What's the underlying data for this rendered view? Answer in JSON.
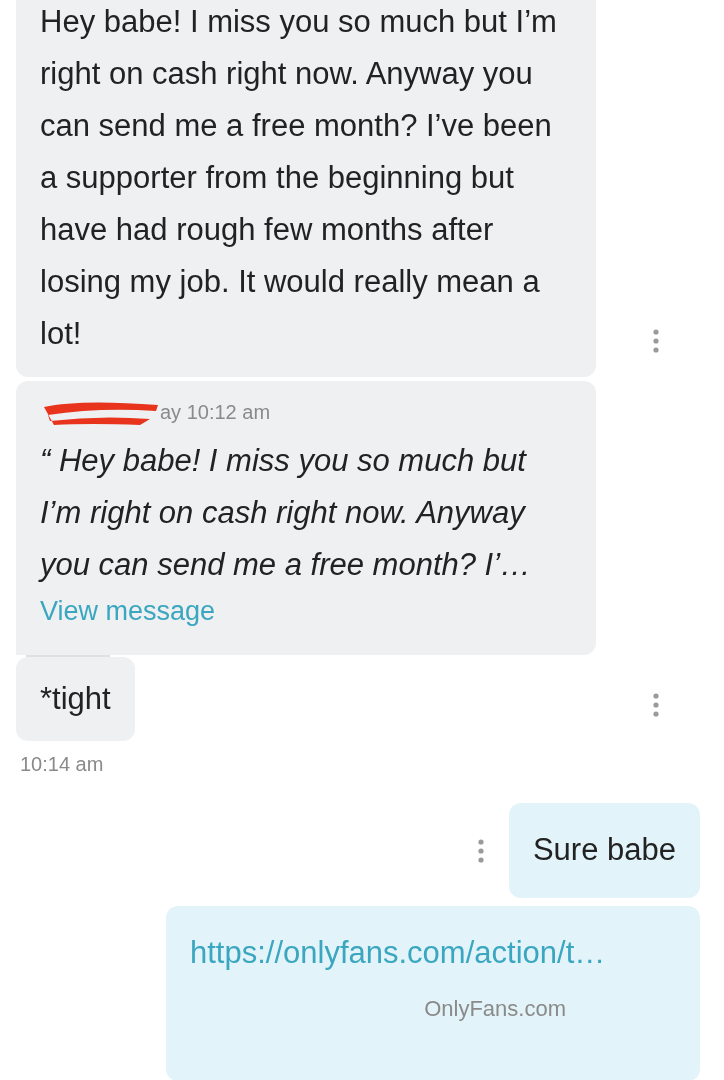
{
  "messages": [
    {
      "kind": "received",
      "text": "Hey babe! I miss you so much but I’m right on cash right now. Anyway you can send me a free month? I’ve been a supporter from the beginning but have had rough few months after losing my job. It would really mean a lot!"
    },
    {
      "kind": "quote",
      "time": "ay 10:12 am",
      "redacted": true,
      "text": "“ Hey babe! I miss you so much but I’m right on cash right now. Anyway you can send me a free month? I’…",
      "link": "View message"
    },
    {
      "kind": "received",
      "text": "*tight"
    },
    {
      "kind": "time",
      "text": "10:14 am"
    },
    {
      "kind": "sent",
      "text": "Sure babe"
    },
    {
      "kind": "link",
      "text": "https://onlyfans.com/action/t…",
      "site": "OnlyFans.com"
    }
  ]
}
